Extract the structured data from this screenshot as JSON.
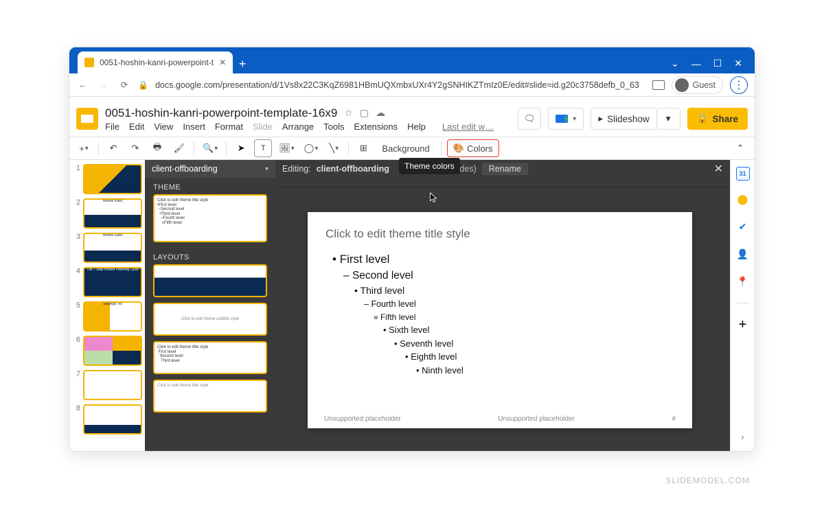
{
  "browser": {
    "tab_title": "0051-hoshin-kanri-powerpoint-t",
    "url": "docs.google.com/presentation/d/1Vs8x22C3KqZ6981HBmUQXmbxUXr4Y2gSNHIKZTmIz0E/edit#slide=id.g20c3758defb_0_63",
    "guest_label": "Guest"
  },
  "app": {
    "doc_title": "0051-hoshin-kanri-powerpoint-template-16x9",
    "menus": [
      "File",
      "Edit",
      "View",
      "Insert",
      "Format",
      "Slide",
      "Arrange",
      "Tools",
      "Extensions",
      "Help"
    ],
    "last_edit": "Last edit w…",
    "slideshow_label": "Slideshow",
    "share_label": "Share"
  },
  "toolbar": {
    "background_label": "Background",
    "colors_label": "Colors",
    "colors_tooltip": "Theme colors"
  },
  "theme_panel": {
    "master_name": "client-offboarding",
    "theme_heading": "THEME",
    "layouts_heading": "LAYOUTS",
    "editing_prefix": "Editing:",
    "editing_scope": "by all slides)",
    "rename_label": "Rename"
  },
  "slide_master": {
    "title_placeholder": "Click to edit theme title style",
    "bullets": [
      "First level",
      "Second level",
      "Third level",
      "Fourth level",
      "Fifth level",
      "Sixth level",
      "Seventh level",
      "Eighth level",
      "Ninth level"
    ],
    "footer_left": "Unsupported placeholder",
    "footer_center": "Unsupported placeholder",
    "footer_right": "#"
  },
  "side_panel": {
    "calendar_day": "31"
  },
  "thumb_labels": [
    "",
    "Hoshin Kanri",
    "Hoshin Kanri",
    "The 7 Step Hoshin Planning Cycle",
    "Strategic Vis",
    "",
    "",
    ""
  ],
  "watermark": "SLIDEMODEL.COM"
}
